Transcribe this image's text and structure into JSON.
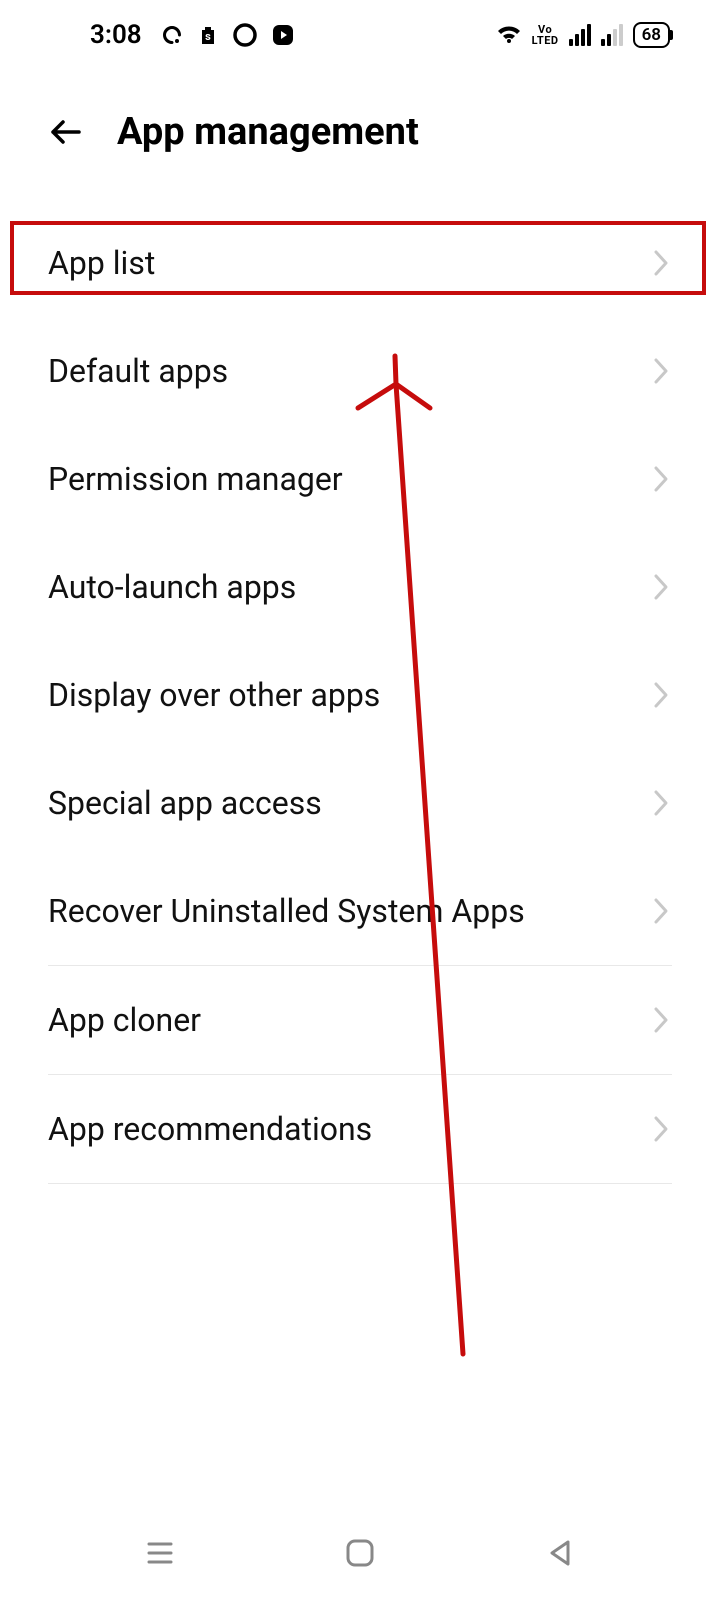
{
  "status": {
    "time": "3:08",
    "battery": "68",
    "volte": "Vo\nLTED"
  },
  "header": {
    "title": "App management"
  },
  "items": [
    {
      "label": "App list"
    },
    {
      "label": "Default apps"
    },
    {
      "label": "Permission manager"
    },
    {
      "label": "Auto-launch apps"
    },
    {
      "label": "Display over other apps"
    },
    {
      "label": "Special app access"
    },
    {
      "label": "Recover Uninstalled System Apps"
    },
    {
      "label": "App cloner"
    },
    {
      "label": "App recommendations"
    }
  ],
  "annotation": {
    "highlight_color": "#c60c0c",
    "arrow_color": "#c60c0c"
  }
}
